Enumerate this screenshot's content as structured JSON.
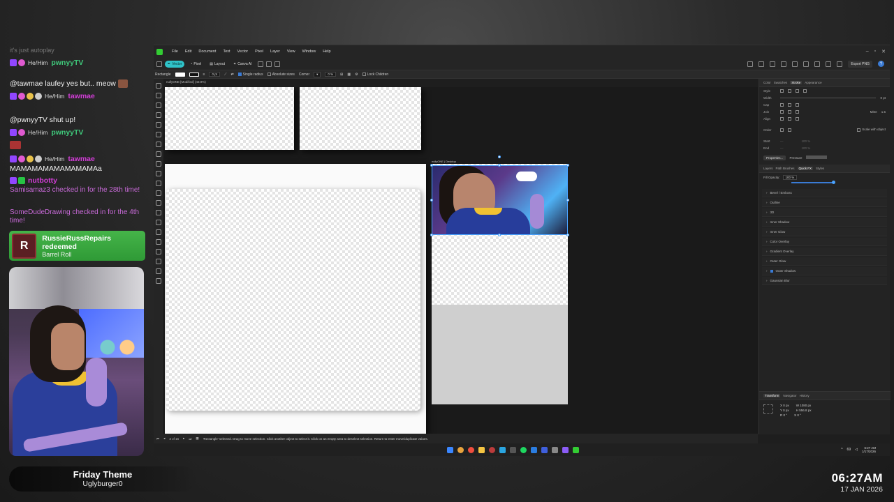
{
  "chat": {
    "faded_top": "it's just autoplay",
    "line1_pronoun": "He/Him",
    "line1_user": "pwnyyTV",
    "msg2": "@tawmae laufey yes but.. meow",
    "line3_pronoun": "He/Him",
    "line3_user": "tawmae",
    "msg4": "@pwnyyTV shut up!",
    "line5_pronoun": "He/Him",
    "line5_user": "pwnyyTV",
    "line6_pronoun": "He/Him",
    "line6_user": "tawmae",
    "msg7": "MAMAMAMAMAMAMAMAa",
    "line8_user": "nutbotty",
    "sys1": "Samisamaz3 checked in for the 28th time!",
    "sys2": "SomeDudeDrawing checked in for the 4th time!"
  },
  "redeem": {
    "icon_letter": "R",
    "title": "RussieRussRepairs redeemed",
    "subtitle": "Barrel Roll"
  },
  "theme": {
    "title": "Friday Theme",
    "subtitle": "Uglyburger0"
  },
  "clock": {
    "time": "06:27AM",
    "date": "17 JAN 2026"
  },
  "app": {
    "menu": [
      "File",
      "Edit",
      "Document",
      "Text",
      "Vector",
      "Pixel",
      "Layer",
      "View",
      "Window",
      "Help"
    ],
    "personas": {
      "vector": "Vector",
      "pixel": "Pixel",
      "layout": "Layout",
      "canva": "Canva AI"
    },
    "export": "Export PNG",
    "ctx": {
      "tool": "Rectangle",
      "stroke_width": "0 pt",
      "single_radius": "Single radius",
      "absolute_sizes": "Absolute sizes",
      "corner": "Corner",
      "corner_val": "0 %",
      "lock_children": "Lock Children"
    },
    "doc_tab": "nullyONE [Modified] (43.9%)",
    "desktop_label": "nullyONE | Desktop",
    "status": {
      "page": "3 of 16",
      "hint": "'Rectangle' selected. Drag to move selection. Click another object to select it. Click on an empty area to deselect selection. Return to enter move/duplicate values."
    },
    "panel": {
      "top_tabs": [
        "Color",
        "Swatches",
        "Stroke",
        "Appearance"
      ],
      "top_active": "Stroke",
      "style_label": "Style",
      "width_label": "Width",
      "width_val": "0 pt",
      "cap_label": "Cap",
      "join_label": "Join",
      "mitre_label": "Mitre",
      "mitre_val": "1.5",
      "align_label": "Align",
      "order_label": "Order",
      "scale_label": "Scale with object",
      "start_label": "Start",
      "end_label": "End",
      "start_val": "100 %",
      "end_val": "100 %",
      "properties": "Properties...",
      "pressure": "Pressure",
      "fx_tabs": [
        "Layers",
        "Path Brushes",
        "Quick FX",
        "Styles"
      ],
      "fx_active": "Quick FX",
      "fill_opacity_label": "Fill Opacity:",
      "fill_opacity_val": "100 %",
      "fill_opacity_fraction": 1.0,
      "effects": [
        {
          "name": "Bevel / Emboss",
          "on": false
        },
        {
          "name": "Outline",
          "on": false
        },
        {
          "name": "3D",
          "on": false
        },
        {
          "name": "Inner Shadow",
          "on": false
        },
        {
          "name": "Inner Glow",
          "on": false
        },
        {
          "name": "Color Overlay",
          "on": false
        },
        {
          "name": "Gradient Overlay",
          "on": false
        },
        {
          "name": "Outer Glow",
          "on": false
        },
        {
          "name": "Outer Shadow",
          "on": true
        },
        {
          "name": "Gaussian Blur",
          "on": false
        }
      ],
      "bottom_tabs": [
        "Transform",
        "Navigator",
        "History"
      ],
      "bottom_active": "Transform",
      "tf_x": "0 px",
      "tf_y": "0 px",
      "tf_w": "1080 px",
      "tf_h": "556.8 px",
      "tf_r": "0 °",
      "tf_s": "0 °"
    },
    "tray": {
      "time": "6:27 AM",
      "date": "1/17/2026",
      "badge": "69"
    }
  },
  "colors": {
    "accent": "#2fc2c8",
    "selection": "#4aa3ff",
    "redeem_green": "#45b449",
    "chat_username_green": "#3fc77a",
    "chat_username_pink": "#d13dd6",
    "chat_system": "#c86ad8"
  }
}
